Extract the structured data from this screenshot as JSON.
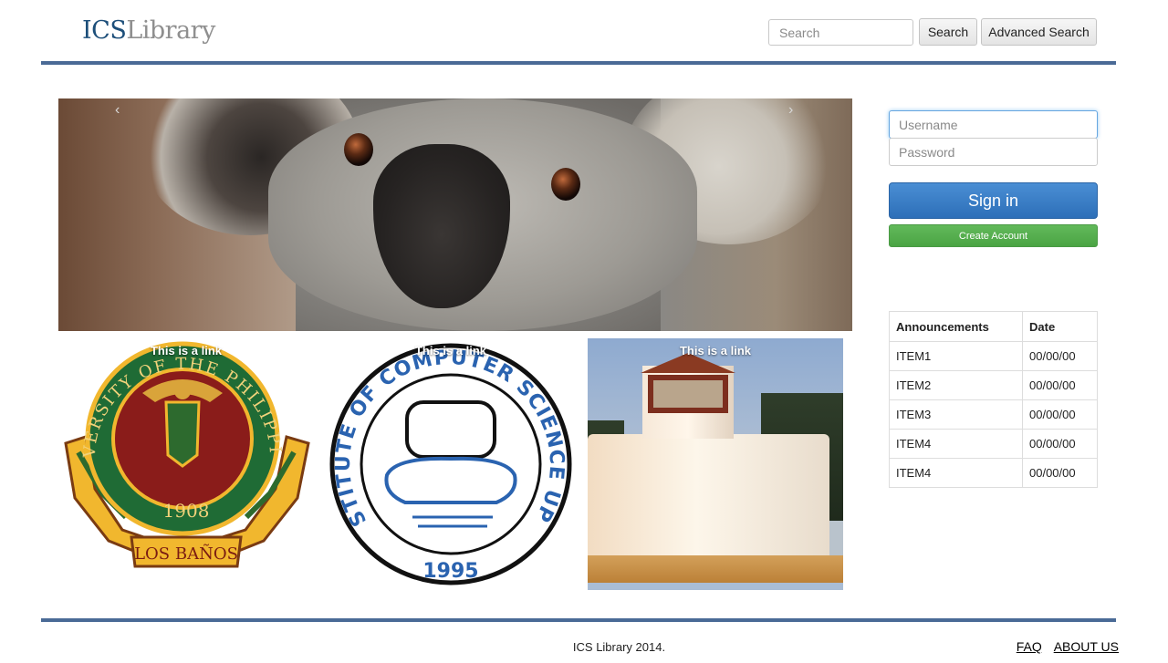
{
  "header": {
    "brand_part1": "ICS",
    "brand_part2": "Library",
    "search_placeholder": "Search",
    "search_button": "Search",
    "advanced_search_button": "Advanced Search"
  },
  "carousel": {
    "prev_icon": "chevron-left-icon",
    "next_icon": "chevron-right-icon"
  },
  "thumbnails": [
    {
      "caption": "This is a link",
      "seal_top": "UNIVERSITY OF THE PHILIPPINES",
      "year": "1908",
      "banner": "LOS BAÑOS"
    },
    {
      "caption": "This is a link",
      "seal_text": "INSTITUTE OF COMPUTER SCIENCE UPLB",
      "year": "1995"
    },
    {
      "caption": "This is a link"
    }
  ],
  "login": {
    "username_placeholder": "Username",
    "password_placeholder": "Password",
    "signin_label": "Sign in",
    "create_label": "Create Account"
  },
  "announcements": {
    "headers": [
      "Announcements",
      "Date"
    ],
    "rows": [
      {
        "item": "ITEM1",
        "date": "00/00/00"
      },
      {
        "item": "ITEM2",
        "date": "00/00/00"
      },
      {
        "item": "ITEM3",
        "date": "00/00/00"
      },
      {
        "item": "ITEM4",
        "date": "00/00/00"
      },
      {
        "item": "ITEM4",
        "date": "00/00/00"
      }
    ]
  },
  "footer": {
    "copyright": "ICS Library 2014.",
    "faq": "FAQ",
    "about": "ABOUT US"
  },
  "colors": {
    "rule": "#4a6a96",
    "primary": "#3278c0",
    "success": "#52ab4b"
  }
}
